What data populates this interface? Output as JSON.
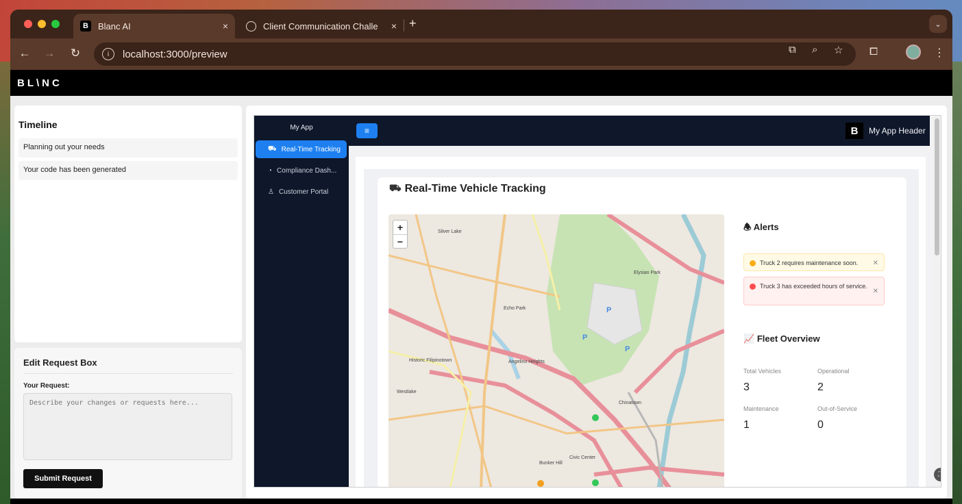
{
  "browser": {
    "tabs": [
      {
        "title": "Blanc AI",
        "favicon": "B",
        "active": true
      },
      {
        "title": "Client Communication Challe",
        "favicon": "",
        "active": false
      }
    ],
    "url": "localhost:3000/preview",
    "tab_close_glyph": "×",
    "new_tab_glyph": "+"
  },
  "brand": {
    "logo": "BL\\NC"
  },
  "timeline": {
    "title": "Timeline",
    "items": [
      "Planning out your needs",
      "Your code has been generated"
    ]
  },
  "edit_request": {
    "title": "Edit Request Box",
    "field_label": "Your Request:",
    "placeholder": "Describe your changes or requests here...",
    "submit_label": "Submit Request"
  },
  "app": {
    "sidebar_title": "My App",
    "nav": [
      {
        "label": "Real-Time Tracking",
        "icon": "car-icon",
        "active": true
      },
      {
        "label": "Compliance Dash...",
        "icon": "dashboard-icon",
        "active": false
      },
      {
        "label": "Customer Portal",
        "icon": "user-icon",
        "active": false
      }
    ],
    "header_logo": "B",
    "header_title": "My App Header",
    "accent": "#1e80f0",
    "page_title": "Real-Time Vehicle Tracking",
    "map": {
      "labels": [
        "Silver Lake",
        "Echo Park",
        "Elysian Park",
        "Historic Filipinotown",
        "Angelino Heights",
        "Chinatown",
        "Westlake",
        "Civic Center",
        "Bunker Hill"
      ],
      "zoom_in": "+",
      "zoom_out": "−"
    },
    "alerts": {
      "title": "Alerts",
      "items": [
        {
          "text": "Truck 2 requires maintenance soon.",
          "level": "warning",
          "color": "#faad14"
        },
        {
          "text": "Truck 3 has exceeded hours of service.",
          "level": "error",
          "color": "#ff4d4f"
        }
      ]
    },
    "fleet": {
      "title": "Fleet Overview",
      "stats": [
        {
          "label": "Total Vehicles",
          "value": "3"
        },
        {
          "label": "Operational",
          "value": "2"
        },
        {
          "label": "Maintenance",
          "value": "1"
        },
        {
          "label": "Out-of-Service",
          "value": "0"
        }
      ]
    }
  }
}
